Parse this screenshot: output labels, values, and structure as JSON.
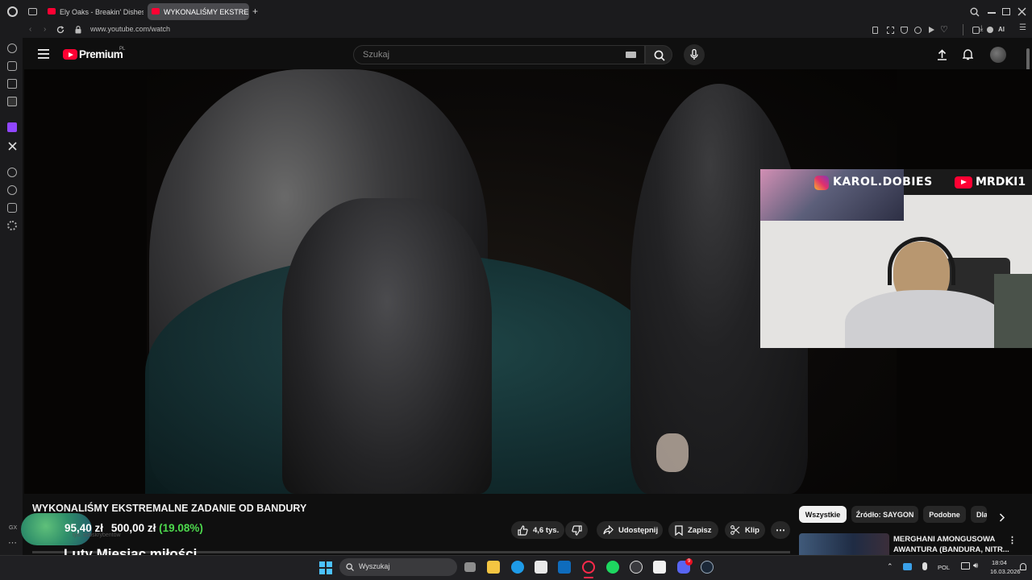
{
  "browser": {
    "tabs": [
      {
        "label": "Ely Oaks - Breakin' Dishes"
      },
      {
        "label": "WYKONALIŚMY EKSTREMAL"
      }
    ],
    "new_tab": "+",
    "url": "www.youtube.com/watch",
    "ai_label": "AI"
  },
  "youtube": {
    "logo_text": "Premium",
    "logo_region": "PL",
    "search_placeholder": "Szukaj"
  },
  "video": {
    "title": "WYKONALIŚMY EKSTREMALNE ZADANIE OD BANDURY",
    "webcam_instagram": "KAROL.DOBIES",
    "webcam_youtube": "MRDKI1"
  },
  "actions": {
    "likes": "4,6 tys.",
    "share": "Udostępnij",
    "save": "Zapisz",
    "clip": "Klip",
    "more": "⋯"
  },
  "recommendations": {
    "chips": [
      "Wszystkie",
      "Źródło: SAYGON",
      "Podobne",
      "Dla"
    ],
    "first_video_title_line1": "MERGHANI AMONGUSOWA",
    "first_video_title_line2": "AWANTURA (BANDURA, NITR..."
  },
  "overlay": {
    "gx": "GX",
    "amount_current": "95,40 zł",
    "amount_goal": "500,00 zł",
    "percent": "(19.08%)",
    "subtitle_hidden": "tys. subskrybentów",
    "title": "Luty Miesiąc miłości"
  },
  "taskbar": {
    "search_placeholder": "Wyszukaj",
    "language": "POL",
    "time": "18:04",
    "date": "16.03.2026",
    "discord_badge": "9"
  },
  "colors": {
    "yt_red": "#ff0033",
    "percent_green": "#4dd94d",
    "background": "#0f0f0f"
  }
}
